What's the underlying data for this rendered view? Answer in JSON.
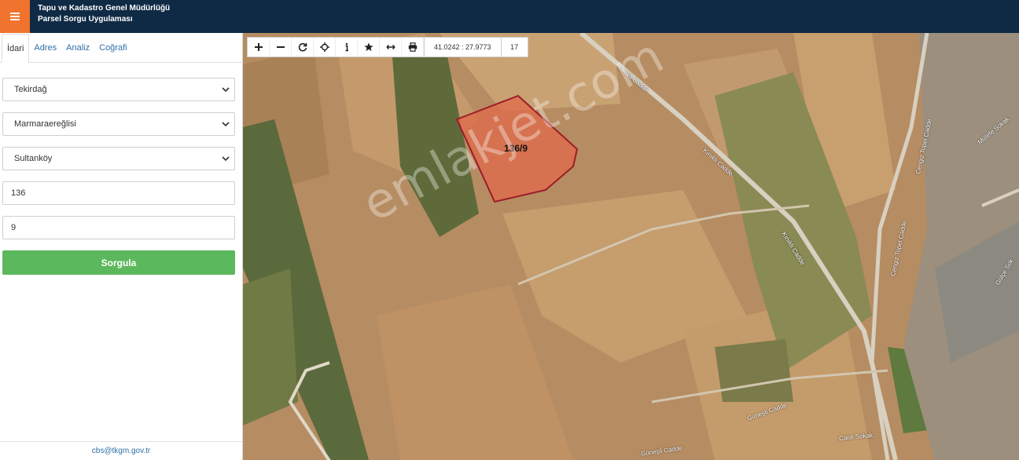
{
  "header": {
    "title_line1": "Tapu ve Kadastro Genel Müdürlüğü",
    "title_line2": "Parsel Sorgu Uygulaması"
  },
  "tabs": [
    {
      "label": "İdari",
      "active": true
    },
    {
      "label": "Adres",
      "active": false
    },
    {
      "label": "Analiz",
      "active": false
    },
    {
      "label": "Coğrafi",
      "active": false
    }
  ],
  "form": {
    "il": "Tekirdağ",
    "ilce": "Marmaraereğlisi",
    "mahalle": "Sultanköy",
    "ada": "136",
    "parsel": "9",
    "submit_label": "Sorgula"
  },
  "footer": {
    "email": "cbs@tkgm.gov.tr"
  },
  "map": {
    "toolbar_icons": [
      "zoom-in-icon",
      "zoom-out-icon",
      "refresh-icon",
      "locate-icon",
      "info-icon",
      "star-icon",
      "measure-icon",
      "print-icon"
    ],
    "coordinates": "41.0242 : 27.9773",
    "zoom_level": "17",
    "parcel_label": "136/9",
    "road_labels": [
      "Kınıklı Cadde",
      "Kınıklı Cadde",
      "Kınıklı Cadde",
      "Cengiz Topel Cadde",
      "Cengiz Topel Cadde",
      "Güneşli Cadde",
      "Güneşli Cadde",
      "Canlı Sokak",
      "Mütefe Sokak",
      "Gülçe Sok"
    ],
    "watermark": "emlakjet.com"
  },
  "colors": {
    "header_bg": "#0f2a44",
    "menu_button": "#f0732e",
    "submit_button": "#5cb85c",
    "parcel_fill": "#e06a4a",
    "parcel_stroke": "#9c1c2a",
    "link": "#2f6ea8"
  }
}
